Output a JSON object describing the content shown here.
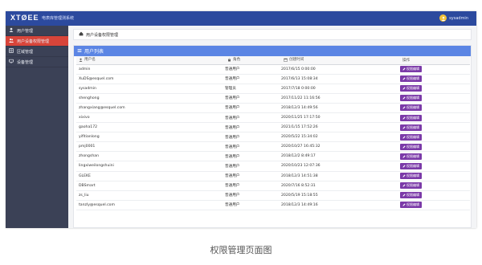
{
  "header": {
    "logo": "XTØEE",
    "system_name": "电表库管理测系统",
    "username": "sysadmin"
  },
  "sidebar": {
    "items": [
      {
        "label": "用户管理",
        "icon": "user-icon",
        "active": false
      },
      {
        "label": "用户设备权限管理",
        "icon": "users-icon",
        "active": true
      },
      {
        "label": "区域管理",
        "icon": "region-icon",
        "active": false
      },
      {
        "label": "设备管理",
        "icon": "device-icon",
        "active": false
      }
    ]
  },
  "breadcrumb": {
    "text": "用户设备权限管理"
  },
  "panel": {
    "title": "用户列表"
  },
  "table": {
    "headers": [
      "用户名",
      "角色",
      "创建时间",
      "操作"
    ],
    "action_label": "权限编辑",
    "rows": [
      {
        "name": "admin",
        "role": "普通用户",
        "time": "2017/6/15 0:00:00"
      },
      {
        "name": "XuDS@esquel.com",
        "role": "普通用户",
        "time": "2017/6/13 15:08:34"
      },
      {
        "name": "sysadmin",
        "role": "管理员",
        "time": "2017/7/18 0:00:00"
      },
      {
        "name": "shenghong",
        "role": "普通用户",
        "time": "2017/11/22 11:16:56"
      },
      {
        "name": "zhangxiang@esquel.com",
        "role": "普通用户",
        "time": "2018/12/3 14:49:56"
      },
      {
        "name": "xixivo",
        "role": "普通用户",
        "time": "2020/11/25 17:17:50"
      },
      {
        "name": "gaoha172",
        "role": "普通用户",
        "time": "2021/1/15 17:52:26"
      },
      {
        "name": "yifitianlong",
        "role": "普通用户",
        "time": "2020/5/22 15:34:02"
      },
      {
        "name": "pmj0001",
        "role": "普通用户",
        "time": "2020/10/27 16:45:32"
      },
      {
        "name": "zhongshan",
        "role": "普通用户",
        "time": "2018/12/2 8:49:17"
      },
      {
        "name": "lingxiweilongshuini",
        "role": "普通用户",
        "time": "2020/10/23 12:07:36"
      },
      {
        "name": "GLEKE",
        "role": "普通用户",
        "time": "2018/12/3 14:51:38"
      },
      {
        "name": "DBSmart",
        "role": "普通用户",
        "time": "2020/7/16 8:52:31"
      },
      {
        "name": "zs_liu",
        "role": "普通用户",
        "time": "2020/5/19 15:18:55"
      },
      {
        "name": "tanzly@esquel.com",
        "role": "普通用户",
        "time": "2018/12/3 14:49:16"
      }
    ]
  },
  "caption": "权限管理页面图",
  "colors": {
    "topbar": "#2c4a9e",
    "sidebar": "#3b4156",
    "active": "#d8453a",
    "panel_head": "#5b85e4",
    "button": "#7b3aa8"
  }
}
